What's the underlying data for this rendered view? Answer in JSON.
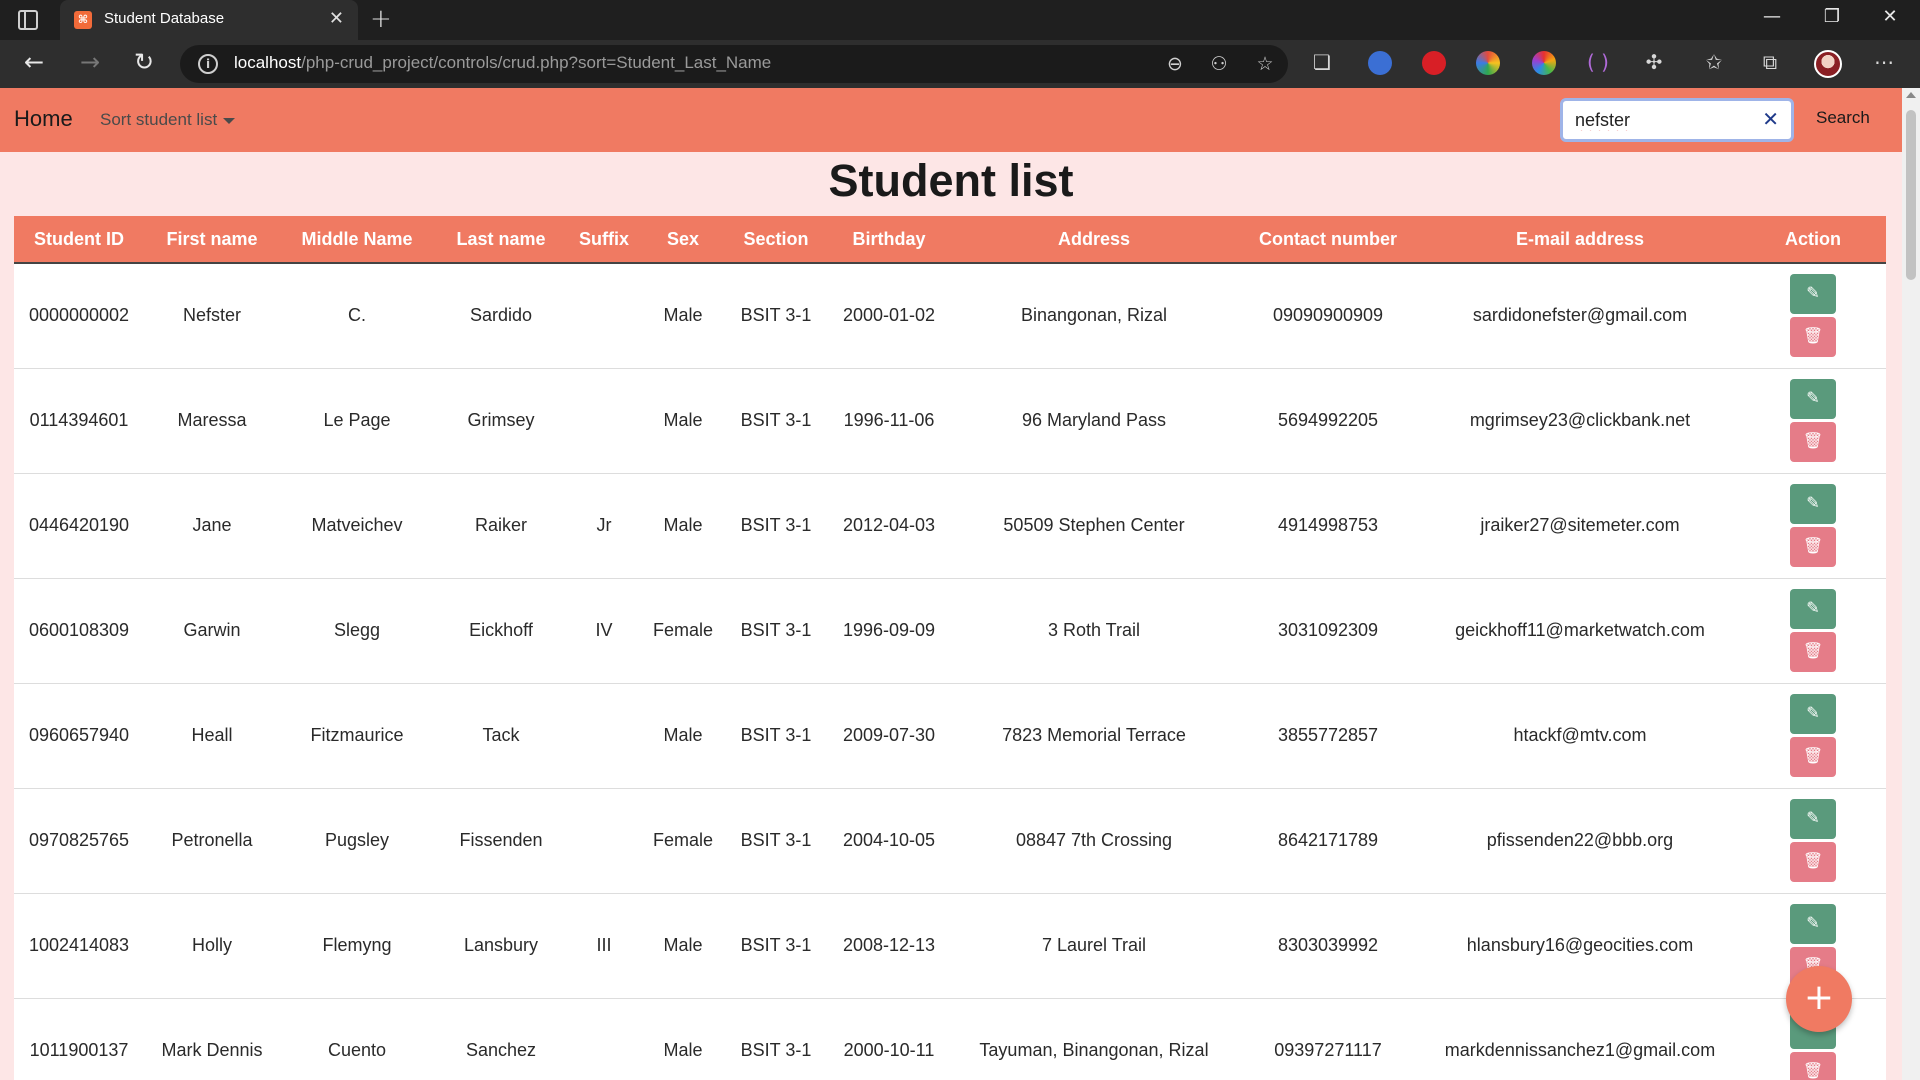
{
  "browser": {
    "tab_title": "Student Database",
    "url_host": "localhost",
    "url_path": "/php-crud_project/controls/crud.php?sort=Student_Last_Name"
  },
  "navbar": {
    "brand": "Home",
    "sort_label": "Sort student list",
    "search_value": "nefster",
    "search_button": "Search"
  },
  "page_title": "Student list",
  "table": {
    "headers": [
      "Student ID",
      "First name",
      "Middle Name",
      "Last name",
      "Suffix",
      "Sex",
      "Section",
      "Birthday",
      "Address",
      "Contact number",
      "E-mail address",
      "Action"
    ],
    "rows": [
      [
        "0000000002",
        "Nefster",
        "C.",
        "Sardido",
        "",
        "Male",
        "BSIT 3-1",
        "2000-01-02",
        "Binangonan, Rizal",
        "09090900909",
        "sardidonefster@gmail.com"
      ],
      [
        "0114394601",
        "Maressa",
        "Le Page",
        "Grimsey",
        "",
        "Male",
        "BSIT 3-1",
        "1996-11-06",
        "96 Maryland Pass",
        "5694992205",
        "mgrimsey23@clickbank.net"
      ],
      [
        "0446420190",
        "Jane",
        "Matveichev",
        "Raiker",
        "Jr",
        "Male",
        "BSIT 3-1",
        "2012-04-03",
        "50509 Stephen Center",
        "4914998753",
        "jraiker27@sitemeter.com"
      ],
      [
        "0600108309",
        "Garwin",
        "Slegg",
        "Eickhoff",
        "IV",
        "Female",
        "BSIT 3-1",
        "1996-09-09",
        "3 Roth Trail",
        "3031092309",
        "geickhoff11@marketwatch.com"
      ],
      [
        "0960657940",
        "Heall",
        "Fitzmaurice",
        "Tack",
        "",
        "Male",
        "BSIT 3-1",
        "2009-07-30",
        "7823 Memorial Terrace",
        "3855772857",
        "htackf@mtv.com"
      ],
      [
        "0970825765",
        "Petronella",
        "Pugsley",
        "Fissenden",
        "",
        "Female",
        "BSIT 3-1",
        "2004-10-05",
        "08847 7th Crossing",
        "8642171789",
        "pfissenden22@bbb.org"
      ],
      [
        "1002414083",
        "Holly",
        "Flemyng",
        "Lansbury",
        "III",
        "Male",
        "BSIT 3-1",
        "2008-12-13",
        "7 Laurel Trail",
        "8303039992",
        "hlansbury16@geocities.com"
      ],
      [
        "1011900137",
        "Mark Dennis",
        "Cuento",
        "Sanchez",
        "",
        "Male",
        "BSIT 3-1",
        "2000-10-11",
        "Tayuman, Binangonan, Rizal",
        "09397271117",
        "markdennissanchez1@gmail.com"
      ]
    ]
  },
  "icons": {
    "edit": "pencil-icon",
    "delete": "trash-icon",
    "fab": "plus-icon"
  },
  "colors": {
    "accent": "#f07a62",
    "page_bg": "#fde6e6",
    "edit_button": "#5a9a7c",
    "delete_button": "#e57c88"
  }
}
